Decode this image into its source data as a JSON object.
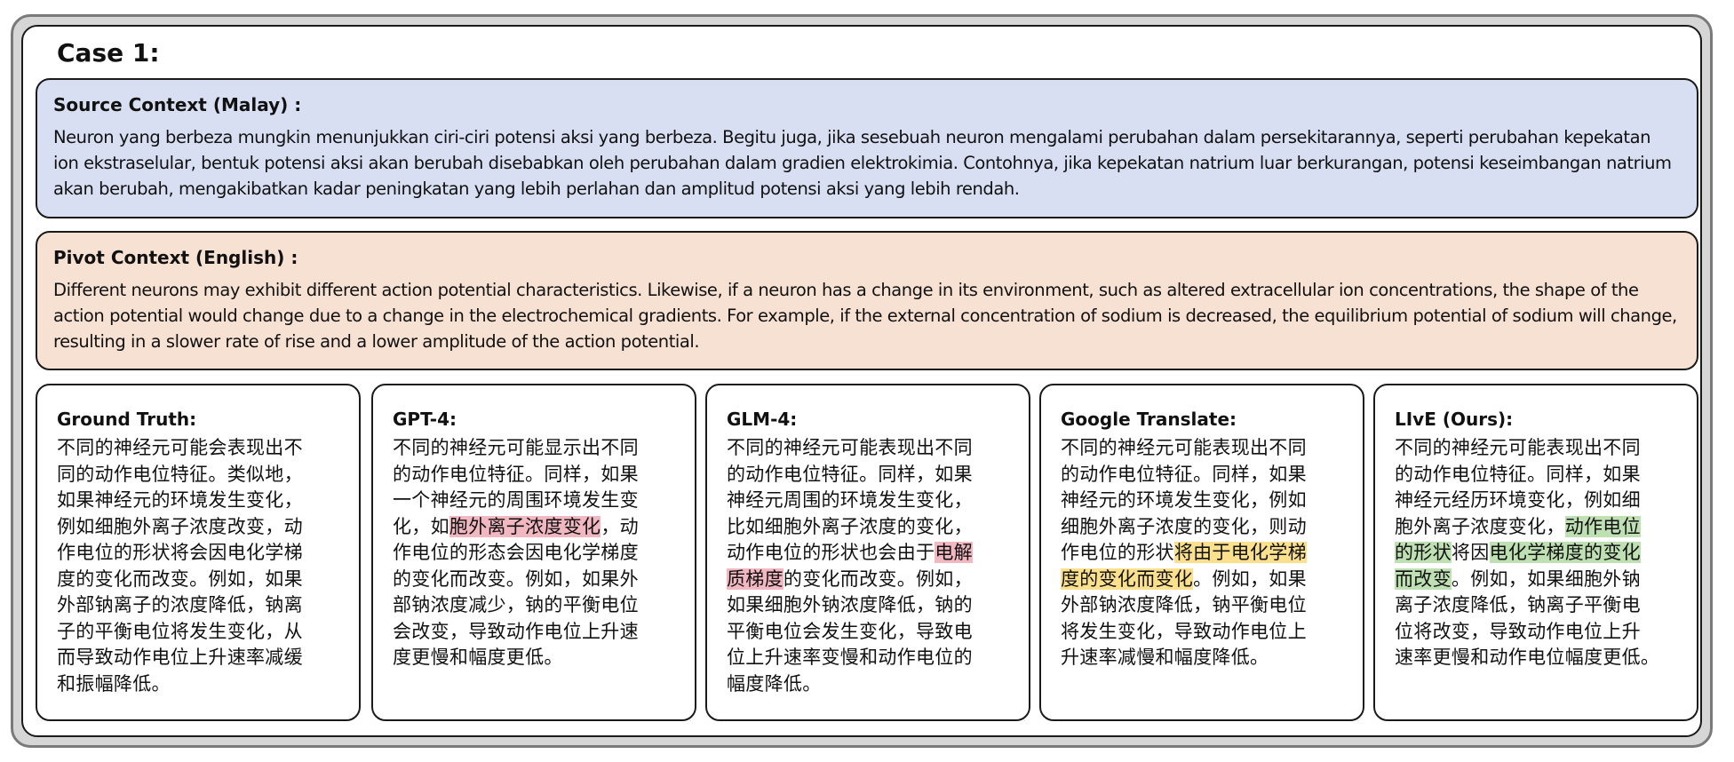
{
  "case_title": "Case 1:",
  "source": {
    "label": "Source Context (Malay) :",
    "text": "Neuron yang berbeza mungkin menunjukkan ciri-ciri potensi aksi yang berbeza. Begitu juga, jika sesebuah neuron mengalami perubahan dalam persekitarannya, seperti perubahan kepekatan ion ekstraselular, bentuk potensi aksi akan berubah disebabkan oleh perubahan dalam gradien elektrokimia. Contohnya, jika kepekatan natrium luar berkurangan, potensi keseimbangan natrium akan berubah, mengakibatkan kadar peningkatan yang lebih perlahan dan amplitud potensi aksi yang lebih rendah."
  },
  "pivot": {
    "label": "Pivot Context (English) :",
    "text": "Different neurons may exhibit different action potential characteristics. Likewise, if a neuron has a change in its environment, such as altered extracellular ion concentrations, the shape of the action potential would change due to a change in the electrochemical gradients. For example, if the external concentration of sodium is decreased, the equilibrium potential of sodium will change, resulting in a slower rate of rise and a lower amplitude of the action potential."
  },
  "highlight_colors": {
    "error": "#f1b8c2",
    "partial": "#fbe08e",
    "correct": "#bfe0b2"
  },
  "cards": [
    {
      "label": "Ground Truth:",
      "lines": [
        [
          {
            "t": "不同的神经元可能会表现出不"
          }
        ],
        [
          {
            "t": "同的动作电位特征。类似地，"
          }
        ],
        [
          {
            "t": "如果神经元的环境发生变化，"
          }
        ],
        [
          {
            "t": "例如细胞外离子浓度改变，动"
          }
        ],
        [
          {
            "t": "作电位的形状将会因电化学梯"
          }
        ],
        [
          {
            "t": "度的变化而改变。例如，如果"
          }
        ],
        [
          {
            "t": "外部钠离子的浓度降低，钠离"
          }
        ],
        [
          {
            "t": "子的平衡电位将发生变化，从"
          }
        ],
        [
          {
            "t": "而导致动作电位上升速率减缓"
          }
        ],
        [
          {
            "t": "和振幅降低。"
          }
        ]
      ]
    },
    {
      "label": "GPT-4:",
      "lines": [
        [
          {
            "t": "不同的神经元可能显示出不同"
          }
        ],
        [
          {
            "t": "的动作电位特征。同样，如果"
          }
        ],
        [
          {
            "t": "一个神经元的周围环境发生变"
          }
        ],
        [
          {
            "t": "化，如"
          },
          {
            "t": "胞外离子浓度变化",
            "hl": "red"
          },
          {
            "t": "，动"
          }
        ],
        [
          {
            "t": "作电位的形态会因电化学梯度"
          }
        ],
        [
          {
            "t": "的变化而改变。例如，如果外"
          }
        ],
        [
          {
            "t": "部钠浓度减少，钠的平衡电位"
          }
        ],
        [
          {
            "t": "会改变，导致动作电位上升速"
          }
        ],
        [
          {
            "t": "度更慢和幅度更低。"
          }
        ]
      ]
    },
    {
      "label": "GLM-4:",
      "lines": [
        [
          {
            "t": "不同的神经元可能表现出不同"
          }
        ],
        [
          {
            "t": "的动作电位特征。同样，如果"
          }
        ],
        [
          {
            "t": "神经元周围的环境发生变化，"
          }
        ],
        [
          {
            "t": "比如细胞外离子浓度的变化，"
          }
        ],
        [
          {
            "t": "动作电位的形状也会由于"
          },
          {
            "t": "电解",
            "hl": "red"
          }
        ],
        [
          {
            "t": "质梯度",
            "hl": "red"
          },
          {
            "t": "的变化而改变。例如，"
          }
        ],
        [
          {
            "t": "如果细胞外钠浓度降低，钠的"
          }
        ],
        [
          {
            "t": "平衡电位会发生变化，导致电"
          }
        ],
        [
          {
            "t": "位上升速率变慢和动作电位的"
          }
        ],
        [
          {
            "t": "幅度降低。"
          }
        ]
      ]
    },
    {
      "label": "Google Translate:",
      "lines": [
        [
          {
            "t": "不同的神经元可能表现出不同"
          }
        ],
        [
          {
            "t": "的动作电位特征。同样，如果"
          }
        ],
        [
          {
            "t": "神经元的环境发生变化，例如"
          }
        ],
        [
          {
            "t": "细胞外离子浓度的变化，则动"
          }
        ],
        [
          {
            "t": "作电位的形状"
          },
          {
            "t": "将由于电化学梯",
            "hl": "yellow"
          }
        ],
        [
          {
            "t": "度的变化而变化",
            "hl": "yellow"
          },
          {
            "t": "。例如，如果"
          }
        ],
        [
          {
            "t": "外部钠浓度降低，钠平衡电位"
          }
        ],
        [
          {
            "t": "将发生变化，导致动作电位上"
          }
        ],
        [
          {
            "t": "升速率减慢和幅度降低。"
          }
        ]
      ]
    },
    {
      "label": "LIvE (Ours):",
      "lines": [
        [
          {
            "t": "不同的神经元可能表现出不同"
          }
        ],
        [
          {
            "t": "的动作电位特征。同样，如果"
          }
        ],
        [
          {
            "t": "神经元经历环境变化，例如细"
          }
        ],
        [
          {
            "t": "胞外离子浓度变化，"
          },
          {
            "t": "动作电位",
            "hl": "green"
          }
        ],
        [
          {
            "t": "的形状",
            "hl": "green"
          },
          {
            "t": "将因"
          },
          {
            "t": "电化学梯度的变化",
            "hl": "green"
          }
        ],
        [
          {
            "t": "而改变",
            "hl": "green"
          },
          {
            "t": "。例如，如果细胞外钠"
          }
        ],
        [
          {
            "t": "离子浓度降低，钠离子平衡电"
          }
        ],
        [
          {
            "t": "位将改变，导致动作电位上升"
          }
        ],
        [
          {
            "t": "速率更慢和动作电位幅度更低。"
          }
        ]
      ]
    }
  ]
}
